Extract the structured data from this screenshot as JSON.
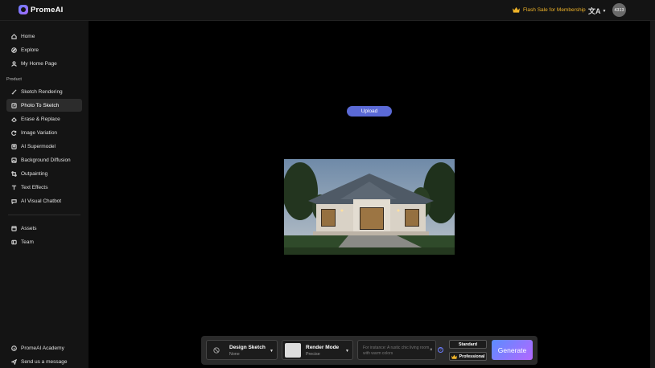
{
  "app": {
    "name": "PromeAI"
  },
  "topbar": {
    "flash_sale": "Flash Sale for Membership",
    "language_glyph": "文A",
    "avatar_text": "4313"
  },
  "sidebar": {
    "items_top": [
      {
        "label": "Home",
        "icon": "home-icon"
      },
      {
        "label": "Explore",
        "icon": "compass-icon"
      },
      {
        "label": "My Home Page",
        "icon": "user-icon"
      }
    ],
    "section_label": "Product",
    "items_product": [
      {
        "label": "Sketch Rendering",
        "icon": "brush-icon"
      },
      {
        "label": "Photo To Sketch",
        "icon": "pencil-square-icon",
        "active": true
      },
      {
        "label": "Erase & Replace",
        "icon": "eraser-icon"
      },
      {
        "label": "Image Variation",
        "icon": "refresh-icon"
      },
      {
        "label": "AI Supermodel",
        "icon": "person-icon"
      },
      {
        "label": "Background Diffusion",
        "icon": "image-icon"
      },
      {
        "label": "Outpainting",
        "icon": "expand-icon"
      },
      {
        "label": "Text Effects",
        "icon": "text-icon"
      },
      {
        "label": "AI Visual Chatbot",
        "icon": "chat-icon"
      }
    ],
    "items_bottom": [
      {
        "label": "Assets",
        "icon": "folder-icon"
      },
      {
        "label": "Team",
        "icon": "team-icon"
      }
    ],
    "footer": [
      {
        "label": "PromeAI Academy",
        "icon": "info-icon"
      },
      {
        "label": "Send us a message",
        "icon": "send-icon"
      }
    ]
  },
  "main": {
    "upload_label": "Upload"
  },
  "toolbar": {
    "design_title": "Design Sketch",
    "design_value": "None",
    "render_title": "Render Mode",
    "render_value": "Precise",
    "prompt_placeholder": "For instance: A rustic chic living room with warm colors",
    "help_glyph": "?",
    "clear_glyph": "×",
    "standard_label": "Standard",
    "professional_label": "Professional",
    "generate_label": "Generate"
  },
  "colors": {
    "accent": "#5b6ad6",
    "flash": "#f0b429",
    "generate_start": "#5b8dff",
    "generate_end": "#b467ff"
  }
}
